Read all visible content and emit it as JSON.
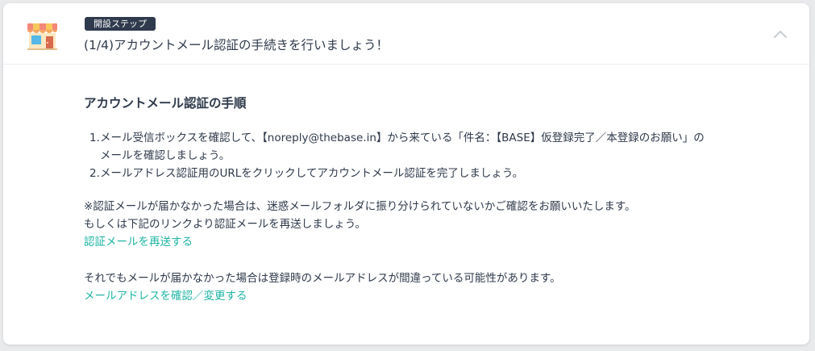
{
  "header": {
    "badge": "開設ステップ",
    "title": "(1/4)アカウントメール認証の手続きを行いましょう！",
    "icon": "shop-icon",
    "toggle_icon": "chevron-up-icon"
  },
  "body": {
    "section_title": "アカウントメール認証の手順",
    "steps": [
      {
        "num": "1.",
        "lines": [
          "メール受信ボックスを確認して、【noreply@thebase.in】から来ている「件名：【BASE】仮登録完了／本登録のお願い」の",
          "メールを確認しましょう。"
        ]
      },
      {
        "num": "2.",
        "lines": [
          "メールアドレス認証用のURLをクリックしてアカウントメール認証を完了しましょう。"
        ]
      }
    ],
    "note_line1": "※認証メールが届かなかった場合は、迷惑メールフォルダに振り分けられていないかご確認をお願いいたします。",
    "note_line2": "もしくは下記のリンクより認証メールを再送しましょう。",
    "resend_link": "認証メールを再送する",
    "fallback_text": "それでもメールが届かなかった場合は登録時のメールアドレスが間違っている可能性があります。",
    "change_email_link": "メールアドレスを確認／変更する"
  },
  "colors": {
    "link": "#1fb5a4",
    "badge_bg": "#2f3a4d",
    "text": "#2f3a4a"
  }
}
